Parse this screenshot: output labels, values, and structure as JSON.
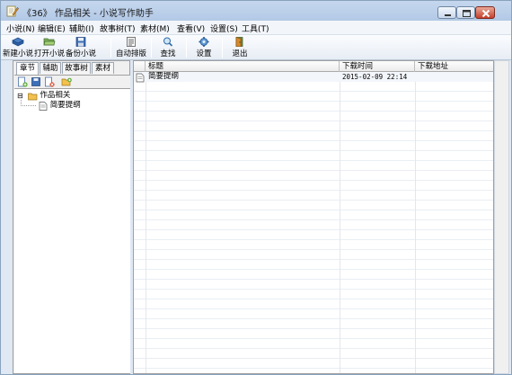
{
  "window": {
    "title": "《36》 作品相关 - 小说写作助手",
    "app_icon": "notepad-pencil-icon",
    "controls": [
      "minimize-icon",
      "maximize-icon",
      "close-icon"
    ]
  },
  "menubar": {
    "items": [
      {
        "label": "小说(N)"
      },
      {
        "label": "编辑(E)"
      },
      {
        "label": "辅助(I)"
      },
      {
        "label": "故事树(T)"
      },
      {
        "label": "素材(M)"
      },
      {
        "label": "查看(V)"
      },
      {
        "label": "设置(S)"
      },
      {
        "label": "工具(T)"
      }
    ]
  },
  "toolbar": {
    "buttons": [
      {
        "label": "新建小说",
        "icon": "new-book-icon"
      },
      {
        "label": "打开小说",
        "icon": "open-folder-icon"
      },
      {
        "label": "备份小说",
        "icon": "save-disk-icon"
      },
      {
        "label": "自动排版",
        "icon": "format-page-icon"
      },
      {
        "label": "查找",
        "icon": "magnifier-icon"
      },
      {
        "label": "设置",
        "icon": "gear-icon"
      },
      {
        "label": "退出",
        "icon": "exit-door-icon"
      }
    ]
  },
  "left_panel": {
    "tabs": [
      {
        "label": "章节",
        "active": true
      },
      {
        "label": "辅助",
        "active": false
      },
      {
        "label": "故事树",
        "active": false
      },
      {
        "label": "素材",
        "active": false
      }
    ],
    "tool_icons": [
      "add-chapter-icon",
      "save-chapter-icon",
      "delete-chapter-icon",
      "add-folder-icon"
    ],
    "tree": {
      "root": {
        "label": "作品相关",
        "expanded": true,
        "icon": "folder-icon",
        "toggle": "⊟"
      },
      "children": [
        {
          "label": "简要提纲",
          "icon": "document-icon"
        }
      ]
    }
  },
  "grid": {
    "columns": [
      {
        "label": "标题"
      },
      {
        "label": "下载时间"
      },
      {
        "label": "下载地址"
      }
    ],
    "rows": [
      {
        "title": "简要提纲",
        "time": "2015-02-09 22:14",
        "url": "",
        "icon": "document-icon"
      }
    ]
  },
  "colors": {
    "titlebar": "#bcd0ea",
    "close_button": "#c4402a",
    "panel_border": "#a0a0a0"
  }
}
